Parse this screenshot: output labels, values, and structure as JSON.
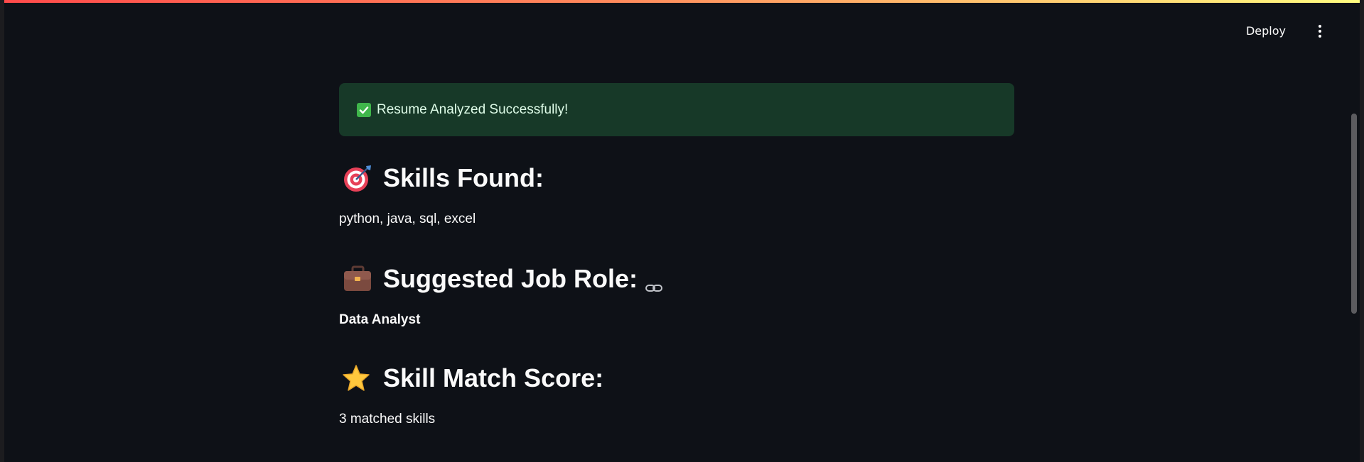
{
  "header": {
    "deploy_label": "Deploy",
    "menu_icon": "kebab-menu-icon"
  },
  "alert": {
    "icon": "check-mark-icon",
    "text": "Resume Analyzed Successfully!",
    "color": "#173928"
  },
  "sections": {
    "skills": {
      "icon": "target-icon",
      "title": "Skills Found:",
      "content": "python, java, sql, excel"
    },
    "job_role": {
      "icon": "briefcase-icon",
      "title": "Suggested Job Role:",
      "link_icon": "link-icon",
      "content": "Data Analyst"
    },
    "match_score": {
      "icon": "star-icon",
      "title": "Skill Match Score:",
      "content": "3 matched skills"
    }
  },
  "colors": {
    "background": "#0e1117",
    "text": "#fafafa",
    "accent_gradient_start": "#ff4b4b",
    "accent_gradient_end": "#fffd80"
  }
}
